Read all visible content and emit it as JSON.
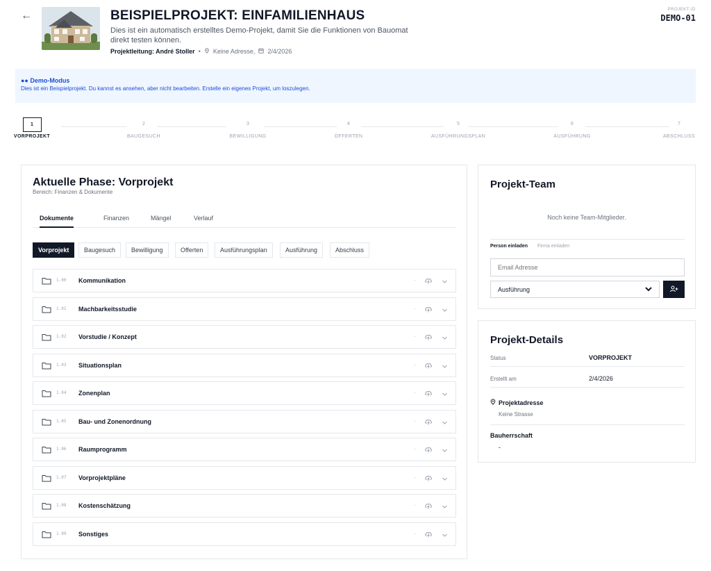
{
  "header": {
    "back_icon": "arrow-left-icon",
    "title": "BEISPIELPROJEKT: EINFAMILIENHAUS",
    "description": "Dies ist ein automatisch erstelltes Demo-Projekt, damit Sie die Funktionen von Bauomat direkt testen können.",
    "lead": "Projektleitung: André Stoller",
    "separator": "•",
    "address": "Keine Adresse,",
    "date": "2/4/2026",
    "project_id_label": "PROJEKT-ID",
    "project_id": "DEMO-01"
  },
  "demo": {
    "title": "Demo-Modus",
    "text": "Dies ist ein Beispielprojekt. Du kannst es ansehen, aber nicht bearbeiten. Erstelle ein eigenes Projekt, um loszulegen.",
    "accent": "#1d4ed8",
    "background": "#eff6ff"
  },
  "stepper": {
    "steps": [
      {
        "num": "1",
        "label": "VORPROJEKT",
        "active": true
      },
      {
        "num": "2",
        "label": "BAUGESUCH",
        "active": false
      },
      {
        "num": "3",
        "label": "BEWILLIGUNG",
        "active": false
      },
      {
        "num": "4",
        "label": "OFFERTEN",
        "active": false
      },
      {
        "num": "5",
        "label": "AUSFÜHRUNGSPLAN",
        "active": false
      },
      {
        "num": "6",
        "label": "AUSFÜHRUNG",
        "active": false
      },
      {
        "num": "7",
        "label": "ABSCHLUSS",
        "active": false
      }
    ]
  },
  "main": {
    "phase_title": "Aktuelle Phase: Vorprojekt",
    "phase_sub": "Bereich: Finanzen & Dokumente",
    "tabs": [
      {
        "label": "Dokumente",
        "active": true
      },
      {
        "label": "Finanzen",
        "active": false
      },
      {
        "label": "Mängel",
        "active": false
      },
      {
        "label": "Verlauf",
        "active": false
      }
    ],
    "phase_pills": [
      {
        "label": "Vorprojekt",
        "active": true
      },
      {
        "label": "Baugesuch",
        "active": false
      },
      {
        "label": "Bewilligung",
        "active": false
      },
      {
        "label": "Offerten",
        "active": false
      },
      {
        "label": "Ausführungsplan",
        "active": false
      },
      {
        "label": "Ausführung",
        "active": false
      },
      {
        "label": "Abschluss",
        "active": false
      }
    ],
    "folders": [
      {
        "code": "1.00",
        "name": "Kommunikation",
        "count": "-"
      },
      {
        "code": "1.01",
        "name": "Machbarkeitsstudie",
        "count": "-"
      },
      {
        "code": "1.02",
        "name": "Vorstudie / Konzept",
        "count": "-"
      },
      {
        "code": "1.03",
        "name": "Situationsplan",
        "count": "-"
      },
      {
        "code": "1.04",
        "name": "Zonenplan",
        "count": "-"
      },
      {
        "code": "1.05",
        "name": "Bau- und Zonenordnung",
        "count": "-"
      },
      {
        "code": "1.06",
        "name": "Raumprogramm",
        "count": "-"
      },
      {
        "code": "1.07",
        "name": "Vorprojektpläne",
        "count": "-"
      },
      {
        "code": "1.08",
        "name": "Kostenschätzung",
        "count": "-"
      },
      {
        "code": "1.99",
        "name": "Sonstiges",
        "count": "-"
      }
    ]
  },
  "team": {
    "title": "Projekt-Team",
    "empty": "Noch keine Team-Mitglieder.",
    "invite_tabs": [
      {
        "label": "Person einladen",
        "active": true
      },
      {
        "label": "Firma einladen",
        "active": false
      }
    ],
    "email_placeholder": "Email Adresse",
    "role_value": "Ausführung"
  },
  "details": {
    "title": "Projekt-Details",
    "status_key": "Status",
    "status_val": "VORPROJEKT",
    "created_key": "Erstellt am",
    "created_val": "2/4/2026",
    "address_title": "Projektadresse",
    "address_val": "Keine Strasse",
    "owner_title": "Bauherrschaft",
    "owner_val": "-"
  }
}
